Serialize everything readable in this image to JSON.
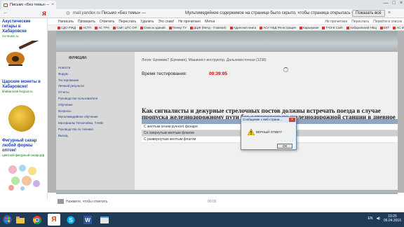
{
  "browser": {
    "tab_title": "Письмо «Без темы» —",
    "tab_close": "×",
    "window_controls": [
      "—",
      "□",
      "×"
    ],
    "url_domain": "mail.yandex.ru",
    "url_page": "Письмо «Без темы» —",
    "warning": "Мультимедийное содержимое на странице было скрыто, чтобы страница открылась быс...",
    "show_all_label": "Показать всё",
    "warning_close": "×",
    "yandex_logo": "Я"
  },
  "yandex_menu": {
    "items": [
      "Написать",
      "Проверить",
      "Ответить",
      "Переслать",
      "Удалить",
      "Это спам!",
      "Не прочитано",
      "Метка"
    ],
    "right": [
      "Не прочитано",
      "Переслать",
      "Перейти в список"
    ]
  },
  "bookmarks": [
    "СДО РЖД",
    "АСТП",
    "АС ТРА",
    "Сайт ЦТС ОЯ",
    "Список зданий",
    "Плеер ТУ",
    "ДЦЖ (Метд - Главная)",
    "Адресная книга",
    "АСУ НБД Регистрация",
    "Карьерная",
    "ТЧЭ-8 Сайт",
    "Хабаровский НБЦ",
    "ЕКТ",
    "АС Инструктор",
    "Cisco"
  ],
  "ads": [
    {
      "title": "Акустические гитары в Хабаровске",
      "url": "rio-music.ru"
    },
    {
      "title": "Царские монеты в Хабаровске!",
      "url": "khabarovsk.fergoot.ru"
    },
    {
      "title": "Фигурный сахар любой формы оптом!",
      "url": "цветной-фигурный-сахар.рф"
    }
  ],
  "sidebar": {
    "heading": "ФУНКЦИИ:",
    "items": [
      "Новости",
      "Форум",
      "Тестирование",
      "Личный результат",
      "Отчеты",
      "Руководство пользователя",
      "Обучение",
      "Вопросы",
      "Мультимедийное обучение",
      "Материалы Тензочейка, ТАМБ",
      "Руководство по технике",
      "Выход"
    ]
  },
  "content": {
    "login": "Логин: Еремкин7 (Еремкин), Машинист-инструктор, Дальневосточная (1238)",
    "time_label": "Время тестирования:",
    "time_value": "00:39:05",
    "question": "Как сигналисты и дежурные стрелочных постов должны встречать поезда в случае пропуска железнодорожному пути без остановки на железнодорожной станции в дневное время?",
    "answers_header": "Варианты ответа",
    "answers": [
      "С желтым огнем ручного фонаря",
      "Со свернутым желтым флагом",
      "С развернутым желтым флагом"
    ]
  },
  "dialog": {
    "title": "Сообщение с веб-страни...",
    "close": "×",
    "message": "ВЕРНЫЙ ОТВЕТ!",
    "ok_label": "ОК"
  },
  "comment": {
    "text": "Нажмите, чтобы ответить",
    "time": "00:00"
  },
  "taskbar": {
    "lang": "EN",
    "time": "19:25",
    "date": "06.04.2016"
  }
}
